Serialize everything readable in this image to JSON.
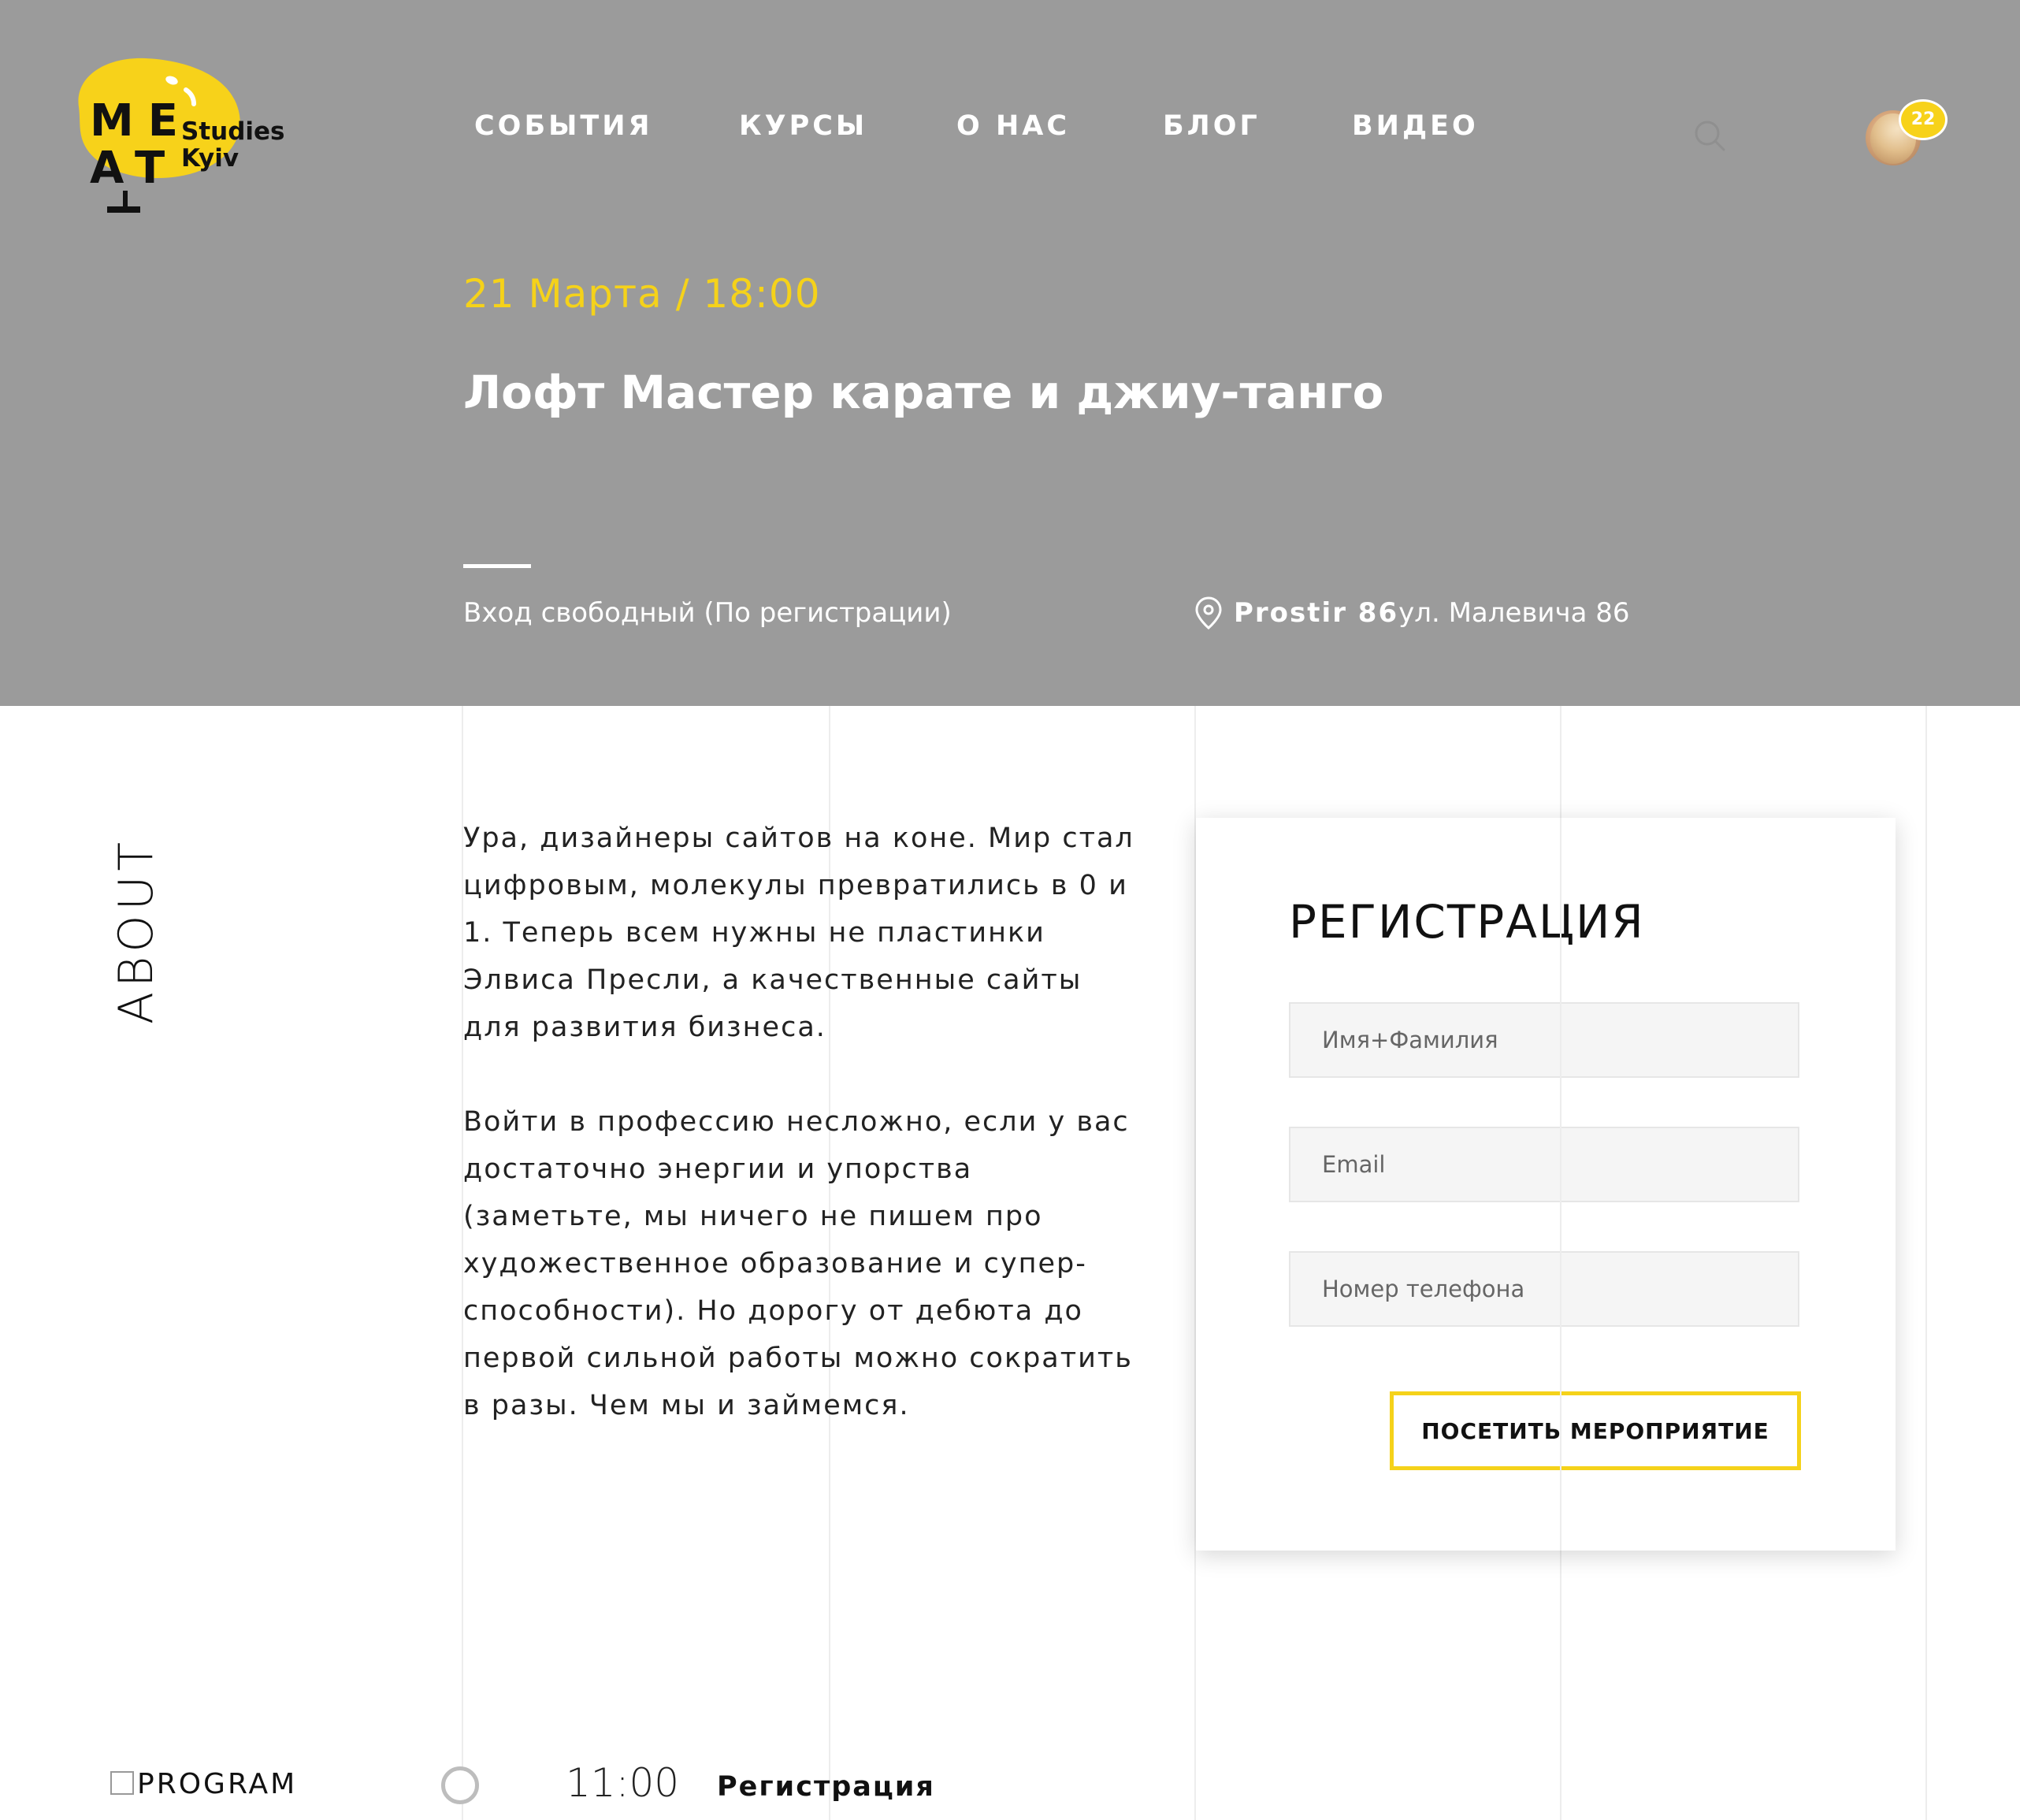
{
  "logo": {
    "letters_top": "ME",
    "letters_bottom": "AT",
    "sub_line1": "Studies",
    "sub_line2": "Kyiv",
    "icon": "meat-studies-logo",
    "accent_color": "#f7d21a"
  },
  "nav": {
    "items": [
      "СОБЫТИЯ",
      "КУРСЫ",
      "О НАС",
      "БЛОГ",
      "ВИДЕО"
    ],
    "search_icon": "search-icon"
  },
  "user": {
    "avatar_icon": "avatar",
    "notifications": "22"
  },
  "event": {
    "date": "21 Марта / 18:00",
    "title": "Лофт Мастер карате и джиу-танго",
    "entry": "Вход свободный (По регистрации)",
    "venue_name": "Prostir 86",
    "venue_address": "ул. Малевича 86",
    "location_icon": "map-pin-icon"
  },
  "about": {
    "label": "ABOUT",
    "paragraph1": "Ура, дизайнеры сайтов на коне. Мир стал цифровым, молекулы превратились в 0 и 1. Теперь всем нужны не пластинки Элвиса Пресли, а качественные сайты для развития бизнеса.",
    "paragraph2": "Войти в профессию несложно, если у вас достаточно энергии и упорства (заметьте, мы ничего не пишем про художественное образование и супер-способности). Но дорогу от дебюта до первой сильной работы можно сократить в разы. Чем мы и займемся."
  },
  "registration": {
    "title": "РЕГИСТРАЦИЯ",
    "name_placeholder": "Имя+Фамилия",
    "email_placeholder": "Email",
    "phone_placeholder": "Номер телефона",
    "submit_label": "ПОСЕТИТЬ МЕРОПРИЯТИЕ"
  },
  "program": {
    "image_alt": "PROGRAM",
    "items": [
      {
        "time": "11:00",
        "title": "Регистрация"
      }
    ]
  },
  "colors": {
    "hero_bg": "#9b9b9b",
    "accent_yellow": "#f5d21a",
    "text_dark": "#111111"
  }
}
